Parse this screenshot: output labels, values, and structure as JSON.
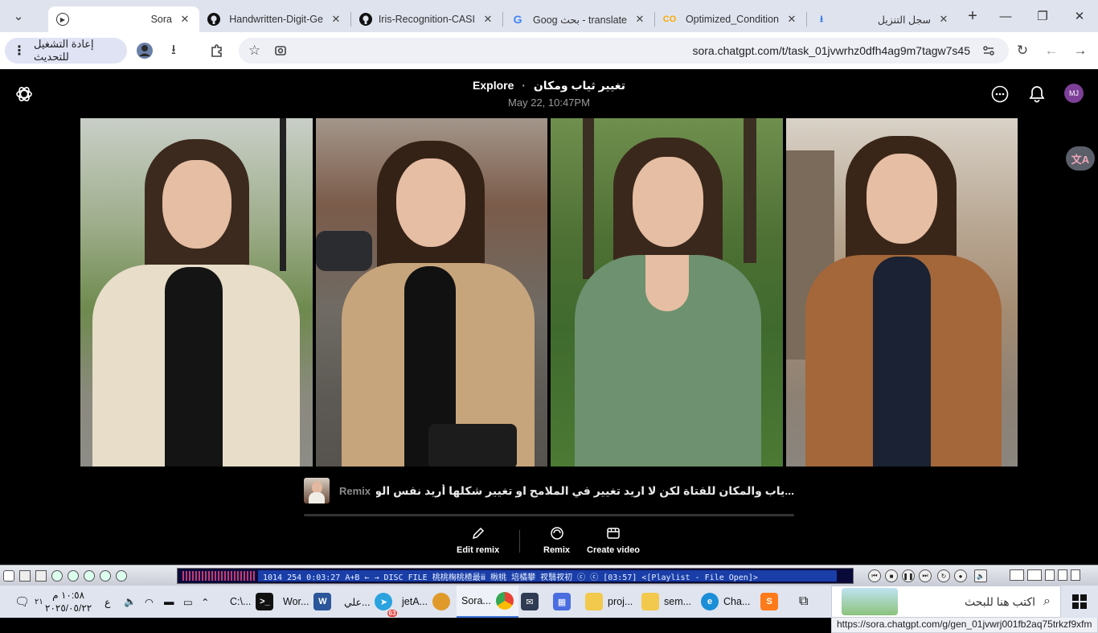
{
  "browser": {
    "tabs": [
      {
        "title": "Sora",
        "icon": "openai-icon",
        "active": true
      },
      {
        "title": "Handwritten-Digit-Ge",
        "icon": "github-icon"
      },
      {
        "title": "Iris-Recognition-CASI",
        "icon": "github-icon"
      },
      {
        "title": "translate - بحث Goog",
        "icon": "google-icon"
      },
      {
        "title": "Optimized_Condition",
        "icon": "colab-icon"
      },
      {
        "title": "سجل التنزيل",
        "icon": "download-icon"
      }
    ],
    "url": "sora.chatgpt.com/t/task_01jvwrhz0dfh4ag9m7tagw7s45",
    "restart_label": "إعادة التشغيل للتحديث"
  },
  "page": {
    "title_ar": "تغيير ثياب ومكان",
    "title_sep": "·",
    "title_explore": "Explore",
    "date": "May 22, 10:47PM",
    "avatar_initials": "MJ",
    "images": [
      {
        "alt": "woman-in-cream-trench-coat-park"
      },
      {
        "alt": "woman-in-beige-trench-coat-street"
      },
      {
        "alt": "woman-in-green-sweater-forest"
      },
      {
        "alt": "woman-in-camel-blazer-city"
      }
    ],
    "remix_label": "Remix",
    "prompt": "...ياب والمكان للفتاة لكن لا اريد تغيير في الملامح او تغيير شكلها أريد نفس الوجه والتفاصيل",
    "actions": {
      "edit_remix": "Edit remix",
      "remix": "Remix",
      "create_video": "Create video"
    },
    "status_url": "https://sora.chatgpt.com/g/gen_01jvwrj001fb2aq75trkzf9xfm"
  },
  "media_player": {
    "lcd_text": "1014  254    0:03:27   A+B ← → DISC FILE   桃桃椈桃楂最ⅲ 楸桃 培橘攀 衩翳衩初 ⓒ ⓒ [03:57]   <[Playlist - File Open]>"
  },
  "taskbar": {
    "search_placeholder": "اكتب هنا للبحث",
    "items": [
      {
        "label": "Cha...",
        "icon": "edge-icon"
      },
      {
        "label": "sem...",
        "icon": "folder-icon"
      },
      {
        "label": "proj...",
        "icon": "folder-icon"
      },
      {
        "label": "Sora...",
        "icon": "chrome-icon"
      },
      {
        "label": "jetA...",
        "icon": "app-icon"
      },
      {
        "label": "علي...",
        "icon": "telegram-icon"
      },
      {
        "label": "Wor...",
        "icon": "word-icon"
      },
      {
        "label": "C:\\...",
        "icon": "terminal-icon"
      }
    ],
    "telegram_badge": "63",
    "time": "١٠:٥٨ م",
    "date": "٢٠٢٥/٠٥/٢٢",
    "lang": "ع",
    "notif_count": "٢١"
  },
  "colors": {
    "accent": "#7d3f98",
    "tabstrip": "#dfe3ee",
    "page_bg": "#000000"
  }
}
